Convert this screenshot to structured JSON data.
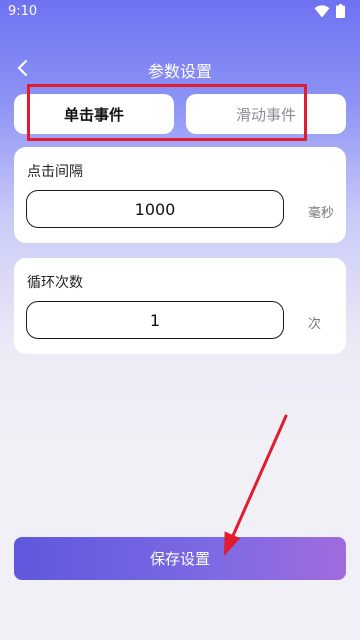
{
  "status_bar": {
    "time": "9:10",
    "icons": [
      "wifi-icon",
      "battery-icon"
    ]
  },
  "header": {
    "title": "参数设置",
    "back_icon": "chevron-left-icon"
  },
  "tabs": [
    {
      "label": "单击事件",
      "selected": true
    },
    {
      "label": "滑动事件",
      "selected": false
    }
  ],
  "click_interval": {
    "label": "点击间隔",
    "value": "1000",
    "unit": "毫秒"
  },
  "loop_count": {
    "label": "循环次数",
    "value": "1",
    "unit": "次"
  },
  "save_button": {
    "label": "保存设置"
  },
  "colors": {
    "accent": "#6e72f2",
    "highlight": "#e01c2e",
    "button_start": "#5e58dc",
    "button_end": "#a16bde"
  }
}
